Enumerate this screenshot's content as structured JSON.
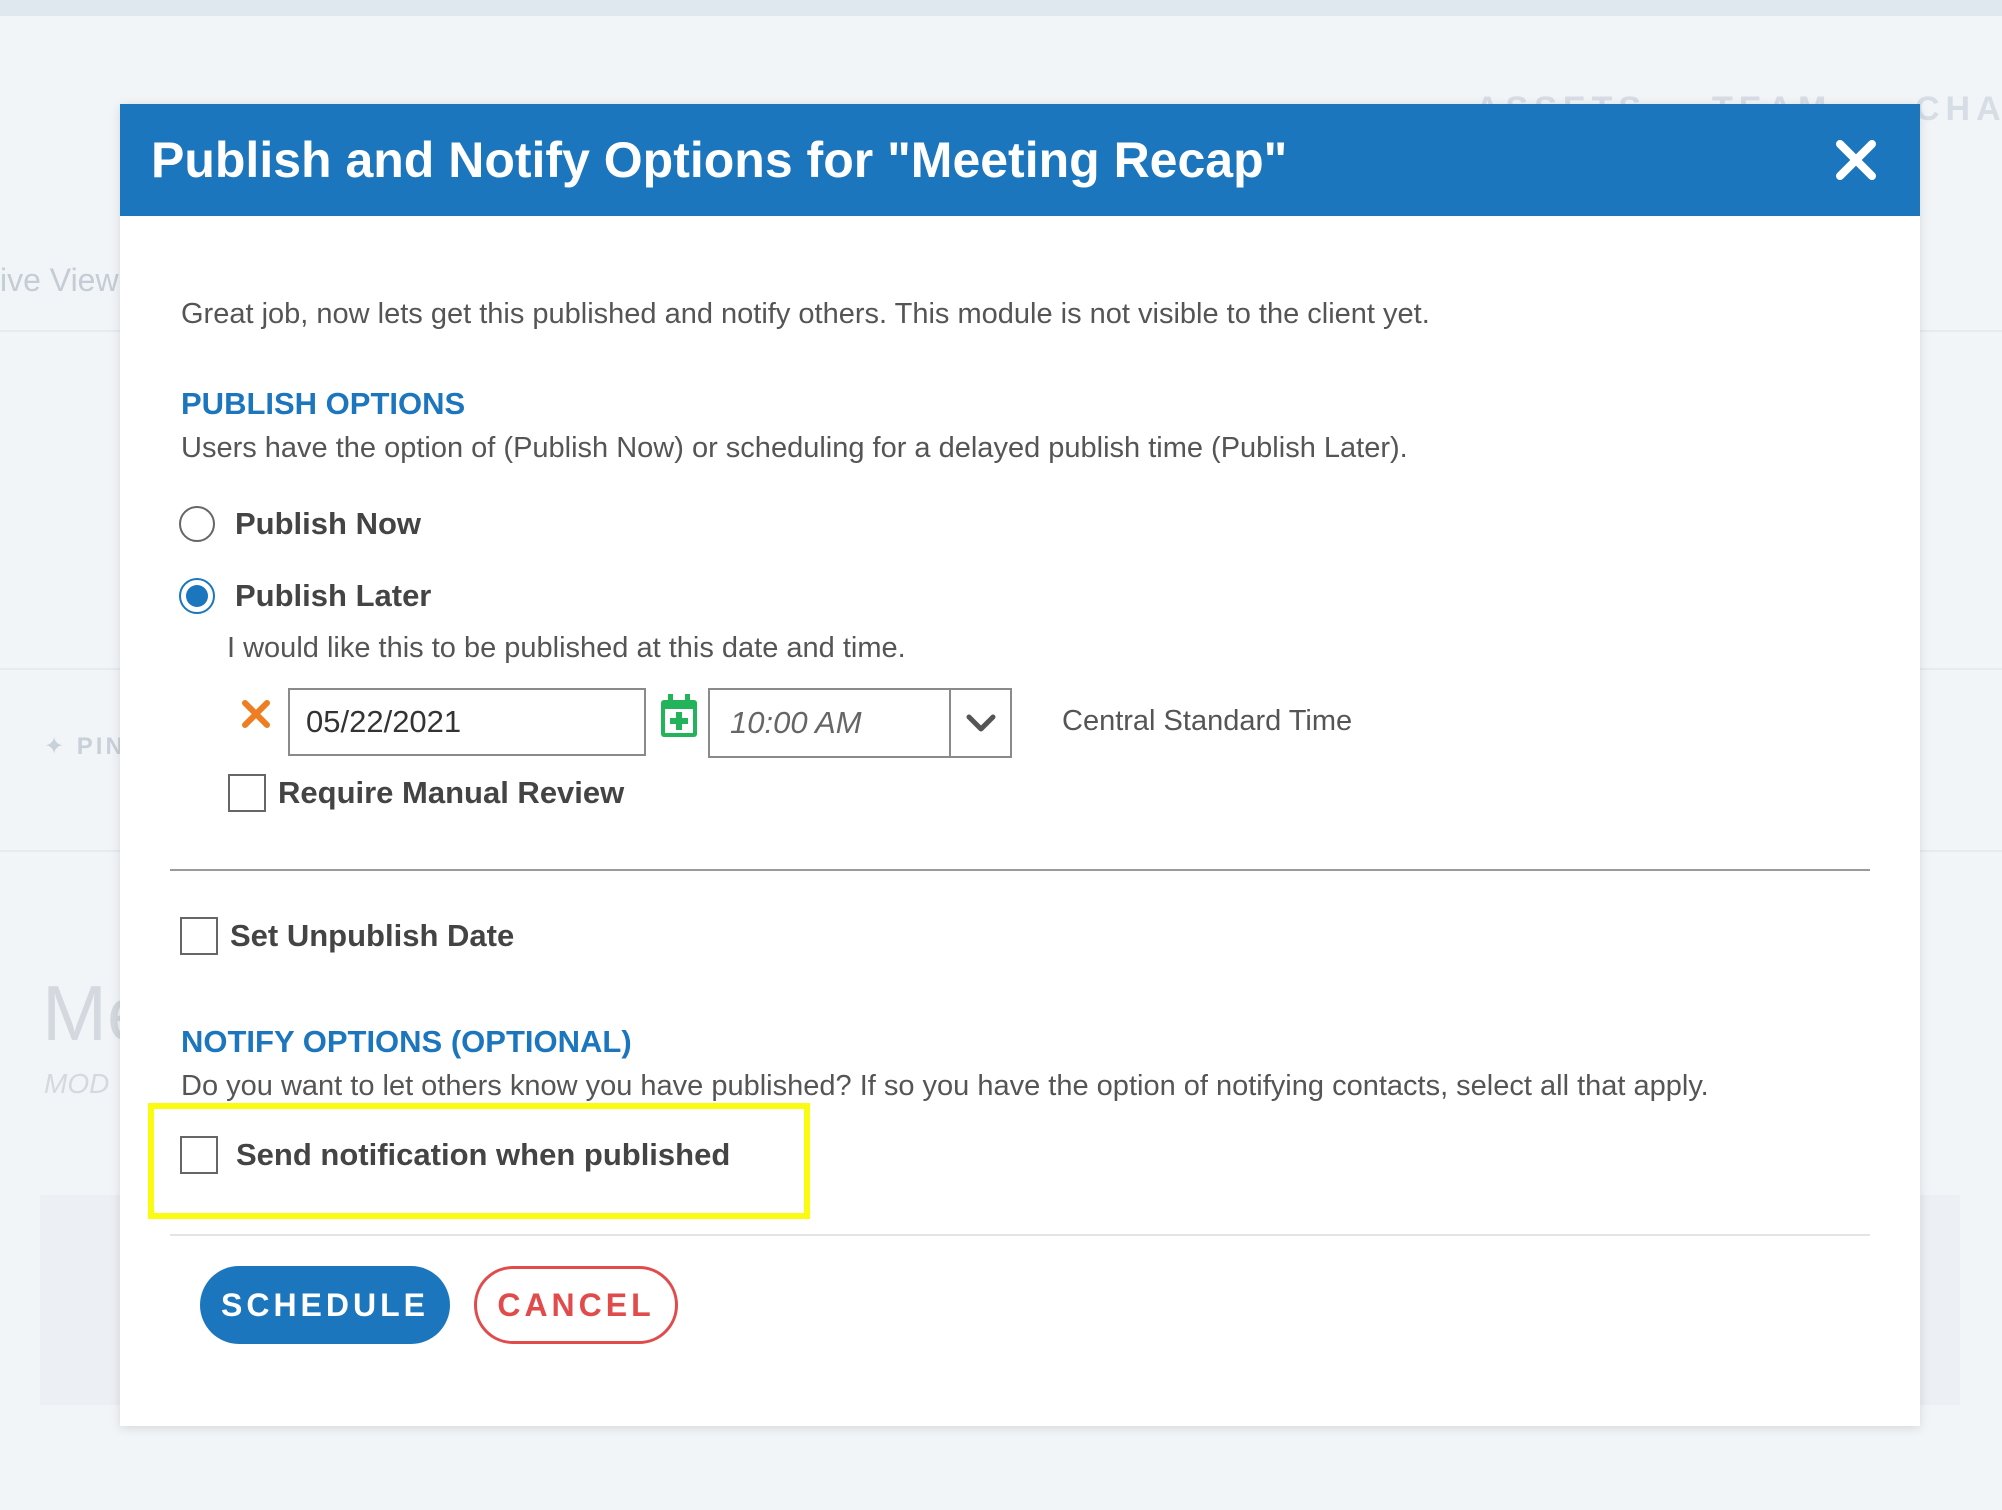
{
  "background": {
    "nav": [
      "ASSETS",
      "TEAM",
      "CHAT"
    ],
    "view_label": "ive View",
    "pin_label": "PIN",
    "page_title": "Me",
    "page_subtitle": "MOD"
  },
  "modal": {
    "title": "Publish and Notify Options for \"Meeting Recap\"",
    "intro": "Great job, now lets get this published and notify others. This module is not visible to the client yet.",
    "publish": {
      "heading": "PUBLISH OPTIONS",
      "description": "Users have the option of (Publish Now) or scheduling for a delayed publish time (Publish Later).",
      "options": [
        {
          "label": "Publish Now",
          "checked": false
        },
        {
          "label": "Publish Later",
          "checked": true
        }
      ],
      "helper": "I would like this to be published at this date and time.",
      "date_value": "05/22/2021",
      "time_value": "10:00 AM",
      "timezone": "Central Standard Time",
      "manual_review_label": "Require Manual Review",
      "manual_review_checked": false
    },
    "unpublish_label": "Set Unpublish Date",
    "notify": {
      "heading": "NOTIFY OPTIONS (OPTIONAL)",
      "description": "Do you want to let others know you have published? If so you have the option of notifying contacts, select all that apply.",
      "send_label": "Send notification when published",
      "send_checked": false
    },
    "buttons": {
      "schedule": "SCHEDULE",
      "cancel": "CANCEL"
    }
  },
  "colors": {
    "accent": "#1c76be",
    "danger": "#e24b4b",
    "calendar": "#22b35b",
    "clear": "#ef7d22",
    "highlight": "#fbfb12"
  }
}
